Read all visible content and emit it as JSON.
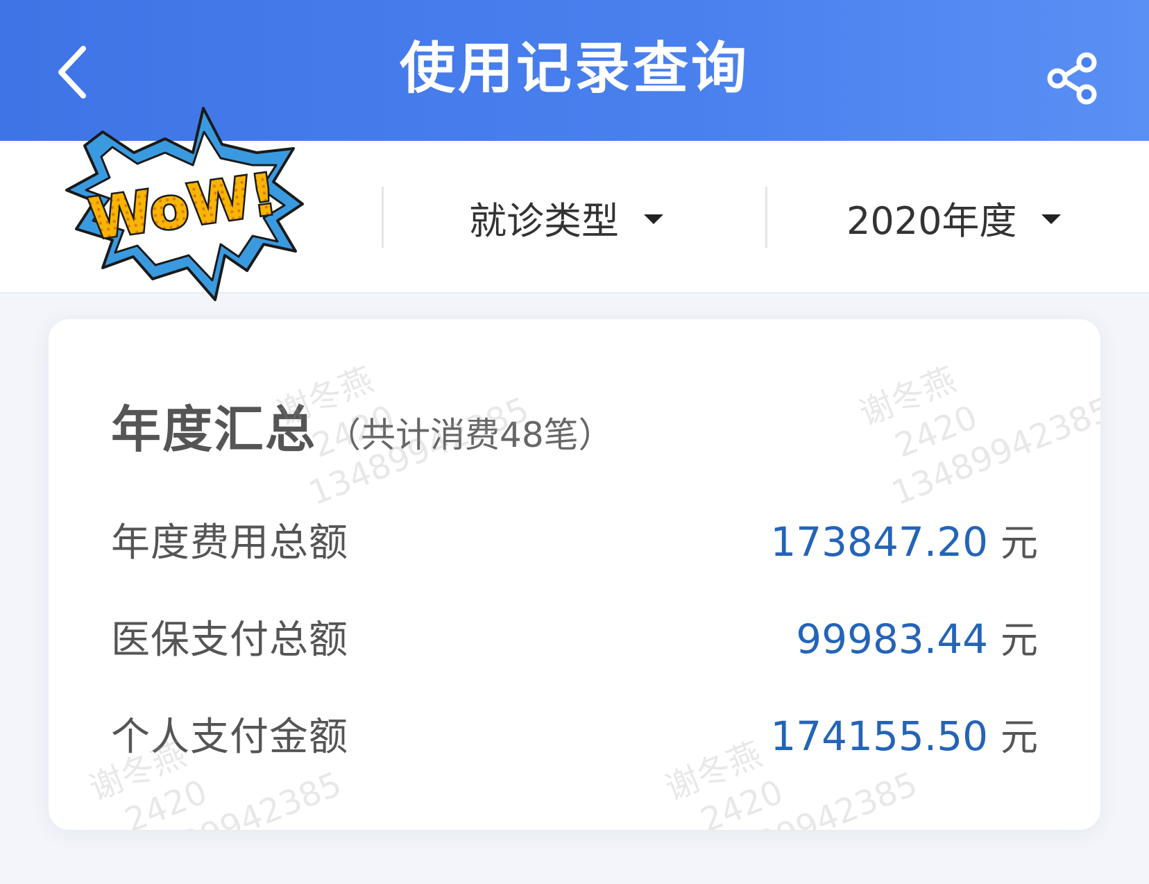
{
  "header": {
    "title": "使用记录查询"
  },
  "filters": {
    "visit_type": "就诊类型",
    "year": "2020年度"
  },
  "summary": {
    "title": "年度汇总",
    "subtitle": "（共计消费48笔）",
    "rows": [
      {
        "label": "年度费用总额",
        "value": "173847.20",
        "unit": "元"
      },
      {
        "label": "医保支付总额",
        "value": "99983.44",
        "unit": "元"
      },
      {
        "label": "个人支付金额",
        "value": "174155.50",
        "unit": "元"
      }
    ]
  },
  "watermark": {
    "name": "谢冬燕",
    "code": "2420",
    "phone": "13489942385"
  },
  "sticker": {
    "text": "WoW!"
  },
  "colors": {
    "header_blue": "#4a80ee",
    "value_blue": "#2464b8",
    "sticker_blue": "#3a9ae0",
    "sticker_yellow": "#f7b500"
  },
  "icons": {
    "back": "chevron-left-icon",
    "share": "share-icon",
    "dropdown": "caret-down-icon"
  }
}
